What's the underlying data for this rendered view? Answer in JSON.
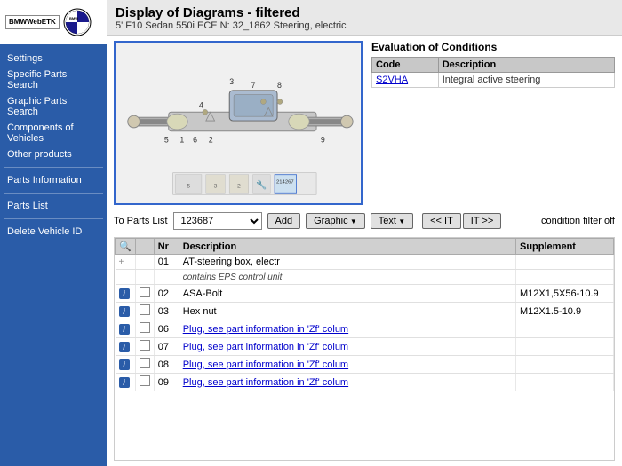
{
  "sidebar": {
    "logo": {
      "etk_text": "BMWWebETK",
      "bmw_alt": "BMW Logo"
    },
    "nav_items": [
      {
        "label": "Settings",
        "id": "settings"
      },
      {
        "label": "Specific Parts Search",
        "id": "specific-parts-search"
      },
      {
        "label": "Graphic Parts Search",
        "id": "graphic-parts-search"
      },
      {
        "label": "Components of Vehicles",
        "id": "components-of-vehicles"
      },
      {
        "label": "Other products",
        "id": "other-products"
      },
      {
        "label": "Parts Information",
        "id": "parts-information"
      },
      {
        "label": "Parts List",
        "id": "parts-list"
      },
      {
        "label": "Delete Vehicle ID",
        "id": "delete-vehicle-id"
      }
    ]
  },
  "header": {
    "title": "Display of Diagrams - filtered",
    "subtitle": "5' F10 Sedan 550i ECE N: 32_1862 Steering, electric"
  },
  "evaluation": {
    "heading": "Evaluation of Conditions",
    "table": {
      "col_code": "Code",
      "col_desc": "Description",
      "rows": [
        {
          "code": "S2VHA",
          "description": "Integral active steering"
        }
      ]
    }
  },
  "toolbar": {
    "parts_list_label": "To Parts List",
    "parts_list_value": "123687",
    "add_btn": "Add",
    "graphic_btn": "Graphic",
    "text_btn": "Text",
    "nav_prev": "<< IT",
    "nav_next": "IT >>",
    "condition_filter": "condition filter off"
  },
  "parts_table": {
    "columns": [
      "",
      "",
      "Nr",
      "Description",
      "Supplement"
    ],
    "rows": [
      {
        "has_info": false,
        "has_cb": false,
        "is_plus": true,
        "nr": "01",
        "description": "AT-steering box, electr",
        "supplement": "",
        "is_sub": false
      },
      {
        "has_info": false,
        "has_cb": false,
        "is_plus": false,
        "nr": "",
        "description": "contains EPS control unit",
        "supplement": "",
        "is_sub": true
      },
      {
        "has_info": true,
        "has_cb": true,
        "is_plus": false,
        "nr": "02",
        "description": "ASA-Bolt",
        "supplement": "M12X1,5X56-10.9",
        "is_sub": false
      },
      {
        "has_info": true,
        "has_cb": true,
        "is_plus": false,
        "nr": "03",
        "description": "Hex nut",
        "supplement": "M12X1.5-10.9",
        "is_sub": false
      },
      {
        "has_info": true,
        "has_cb": true,
        "is_plus": false,
        "nr": "06",
        "description": "Plug, see part information in 'Zf' colum",
        "supplement": "",
        "is_sub": false,
        "desc_link": true
      },
      {
        "has_info": true,
        "has_cb": true,
        "is_plus": false,
        "nr": "07",
        "description": "Plug, see part information in 'Zf' colum",
        "supplement": "",
        "is_sub": false,
        "desc_link": true
      },
      {
        "has_info": true,
        "has_cb": true,
        "is_plus": false,
        "nr": "08",
        "description": "Plug, see part information in 'Zf' colum",
        "supplement": "",
        "is_sub": false,
        "desc_link": true
      },
      {
        "has_info": true,
        "has_cb": true,
        "is_plus": false,
        "nr": "09",
        "description": "Plug, see part information in 'Zf' colum",
        "supplement": "",
        "is_sub": false,
        "desc_link": true
      }
    ]
  }
}
